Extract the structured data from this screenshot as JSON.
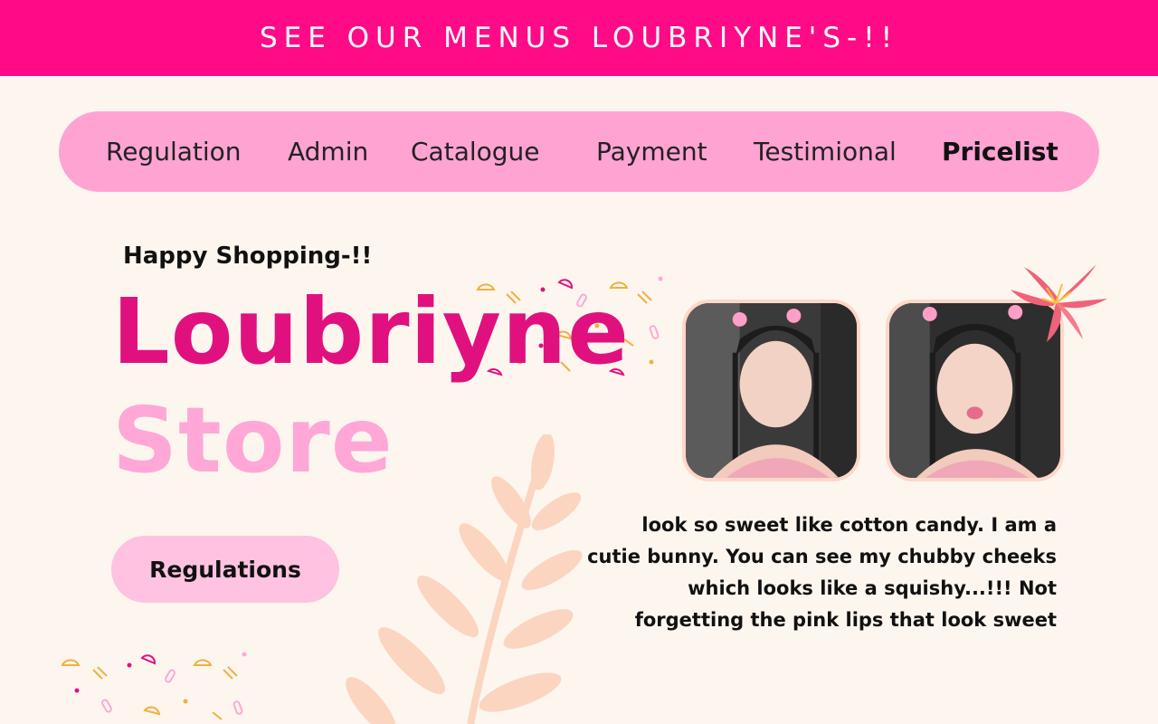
{
  "banner": {
    "text": "SEE OUR MENUS LOUBRIYNE'S-!!"
  },
  "nav": {
    "items": [
      {
        "label": "Regulation"
      },
      {
        "label": "Admin"
      },
      {
        "label": "Catalogue"
      },
      {
        "label": "Payment"
      },
      {
        "label": "Testimional"
      },
      {
        "label": "Pricelist"
      }
    ],
    "active": "Pricelist"
  },
  "hero": {
    "greeting": "Happy Shopping-!!",
    "title_line1": "Loubriyne",
    "title_line2": "Store",
    "button_label": "Regulations"
  },
  "description": "look so sweet like cotton candy. I am a cutie bunny. You can see my chubby cheeks which looks like a squishy...!!! Not forgetting the pink lips that look sweet",
  "icons": [
    "lily-flower-icon",
    "leaf-branch-icon",
    "confetti-icon"
  ],
  "colors": {
    "banner": "#ff0a87",
    "nav_bg": "#ffa3d3",
    "title_primary": "#e0117f",
    "title_secondary": "#ffa7d6",
    "button_bg": "#ffc2e0",
    "page_bg": "#fdf6ef"
  }
}
